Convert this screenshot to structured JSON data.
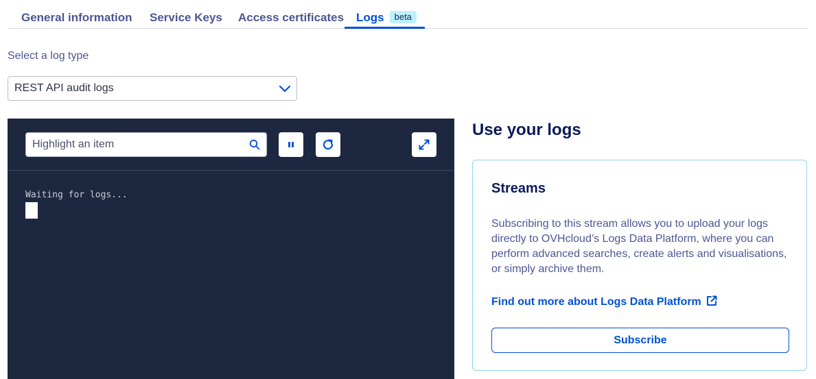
{
  "tabs": [
    {
      "label": "General information"
    },
    {
      "label": "Service Keys"
    },
    {
      "label": "Access certificates"
    },
    {
      "label": "Logs",
      "badge": "beta",
      "active": true
    }
  ],
  "log_type": {
    "label": "Select a log type",
    "selected": "REST API audit logs"
  },
  "console": {
    "search_placeholder": "Highlight an item",
    "buttons": [
      "pause-icon",
      "refresh-icon",
      "expand-icon"
    ],
    "output": "Waiting for logs..."
  },
  "use_logs": {
    "title": "Use your logs",
    "card": {
      "title": "Streams",
      "description": "Subscribing to this stream allows you to upload your logs directly to OVHcloud’s Logs Data Platform, where you can perform advanced searches, create alerts and visualisations, or simply archive them.",
      "link": "Find out more about Logs Data Platform",
      "button": "Subscribe"
    }
  },
  "colors": {
    "accent": "#0050d7",
    "console_bg": "#1e2740",
    "card_border": "#8ed5e8",
    "badge_bg": "#bef1ff"
  }
}
